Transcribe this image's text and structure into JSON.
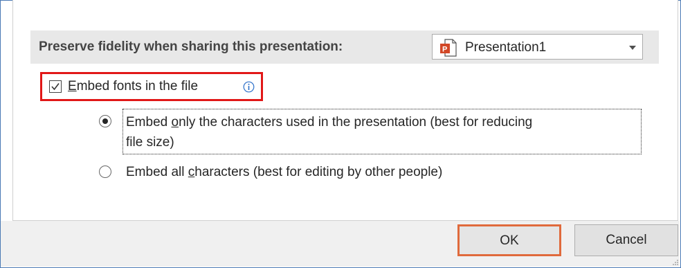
{
  "section": {
    "title": "Preserve fidelity when sharing this presentation:",
    "presentation_select": {
      "value": "Presentation1",
      "icon": "powerpoint-file-icon"
    }
  },
  "embed_fonts": {
    "label_accel": "E",
    "label_rest": "mbed fonts in the file",
    "checked": true,
    "info_icon": "info-icon"
  },
  "options": [
    {
      "part1": "Embed ",
      "accel": "o",
      "part2": "nly the characters used in the presentation (best for reducing",
      "line2": "file size)",
      "selected": true
    },
    {
      "part1": "Embed all ",
      "accel": "c",
      "part2": "haracters (best for editing by other people)",
      "selected": false
    }
  ],
  "buttons": {
    "ok": "OK",
    "cancel": "Cancel"
  },
  "colors": {
    "highlight_red": "#e11717",
    "ok_border": "#e06a3c",
    "window_border": "#4a79b4",
    "powerpoint_orange": "#d24726"
  }
}
